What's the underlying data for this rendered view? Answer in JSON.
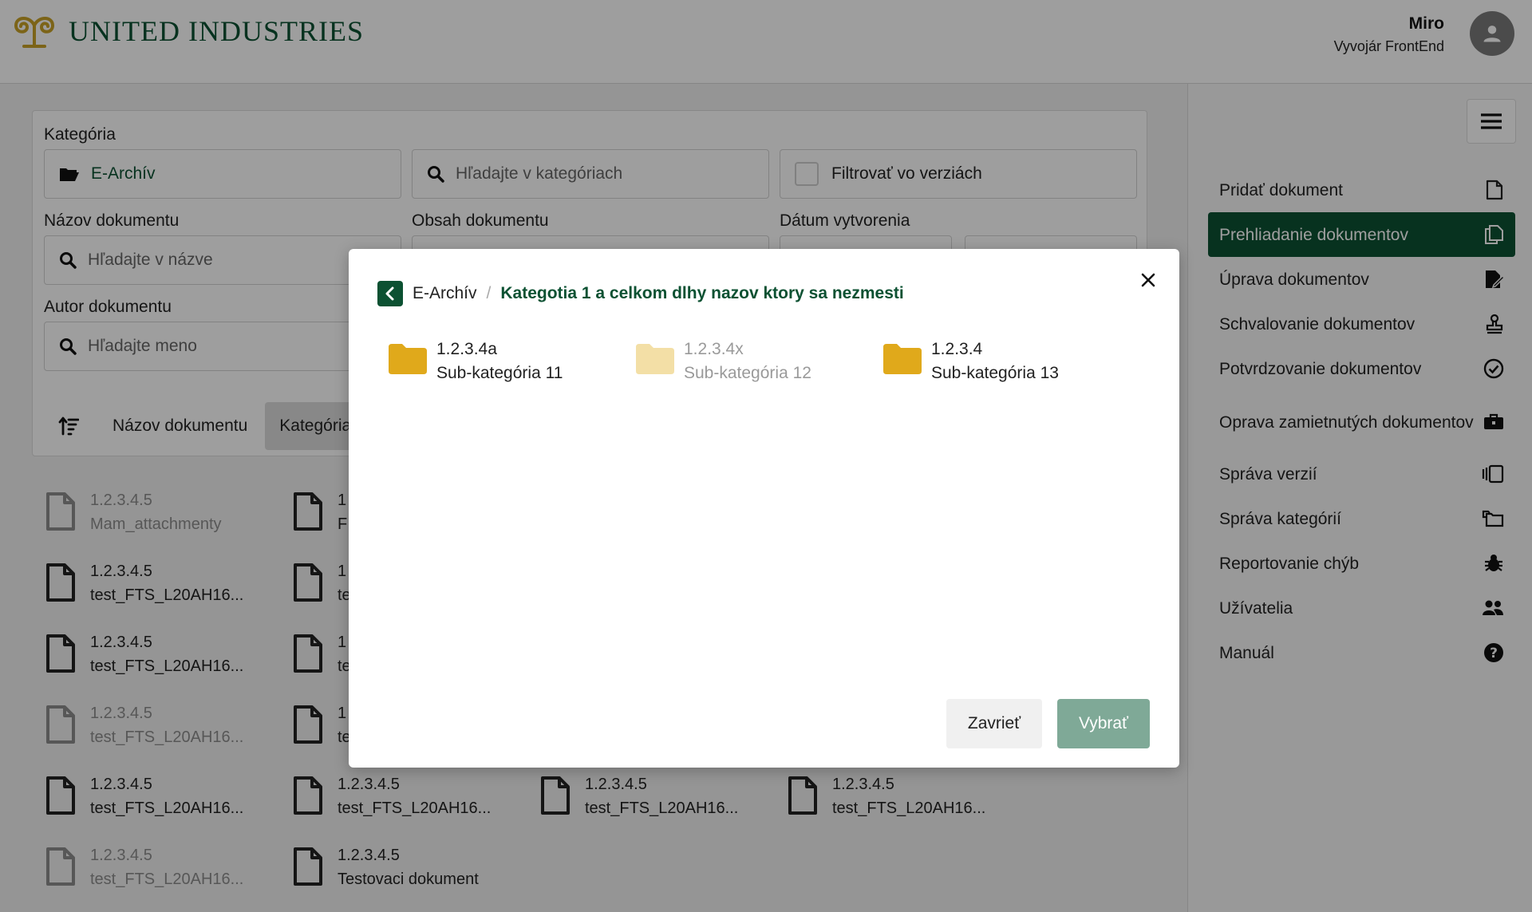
{
  "header": {
    "brand": "UNITED INDUSTRIES",
    "user_name": "Miro",
    "user_role": "Vyvojár FrontEnd"
  },
  "filters": {
    "category_label": "Kategória",
    "category_value": "E-Archív",
    "category_search_placeholder": "Hľadajte v kategóriach",
    "filter_versions_label": "Filtrovať vo verziách",
    "doc_name_label": "Názov dokumentu",
    "doc_name_placeholder": "Hľadajte v názve",
    "doc_content_label": "Obsah dokumentu",
    "created_label": "Dátum vytvorenia",
    "author_label": "Autor dokumentu",
    "author_placeholder": "Hľadajte meno"
  },
  "sort": {
    "name_label": "Názov dokumentu",
    "category_label": "Kategória"
  },
  "files": [
    {
      "id": "1.2.3.4.5",
      "name": "Mam_attachmenty",
      "dim": true
    },
    {
      "id": "1",
      "name": "F",
      "dim": false
    },
    {
      "id": "1.2.3.4.5",
      "name": "test_FTS_L20AH16...",
      "dim": false
    },
    {
      "id": "1",
      "name": "te",
      "dim": false
    },
    {
      "id": "1.2.3.4.5",
      "name": "test_FTS_L20AH16...",
      "dim": false
    },
    {
      "id": "1",
      "name": "te",
      "dim": false
    },
    {
      "id": "1.2.3.4.5",
      "name": "test_FTS_L20AH16...",
      "dim": true
    },
    {
      "id": "1",
      "name": "te",
      "dim": false
    },
    {
      "id": "1.2.3.4.5",
      "name": "test_FTS_L20AH16...",
      "dim": false
    },
    {
      "id": "1.2.3.4.5",
      "name": "test_FTS_L20AH16...",
      "dim": false
    },
    {
      "id": "1.2.3.4.5",
      "name": "test_FTS_L20AH16...",
      "dim": false
    },
    {
      "id": "1.2.3.4.5",
      "name": "test_FTS_L20AH16...",
      "dim": false
    },
    {
      "id": "1.2.3.4.5",
      "name": "test_FTS_L20AH16...",
      "dim": true
    },
    {
      "id": "1.2.3.4.5",
      "name": "Testovaci dokument",
      "dim": false
    }
  ],
  "nav": [
    {
      "label": "Pridať dokument",
      "icon": "file-add-icon"
    },
    {
      "label": "Prehliadanie dokumentov",
      "icon": "files-icon",
      "active": true
    },
    {
      "label": "Úprava dokumentov",
      "icon": "file-edit-icon"
    },
    {
      "label": "Schvalovanie dokumentov",
      "icon": "stamp-icon"
    },
    {
      "label": "Potvrdzovanie dokumentov",
      "icon": "check-circle-icon"
    },
    {
      "label": "Oprava zamietnutých dokumentov",
      "icon": "toolbox-icon"
    },
    {
      "label": "Správa verzií",
      "icon": "versions-icon"
    },
    {
      "label": "Správa kategórií",
      "icon": "folders-icon"
    },
    {
      "label": "Reportovanie chýb",
      "icon": "bug-icon"
    },
    {
      "label": "Užívatelia",
      "icon": "users-icon"
    },
    {
      "label": "Manuál",
      "icon": "help-icon"
    }
  ],
  "modal": {
    "breadcrumb_root": "E-Archív",
    "breadcrumb_current": "Kategotia 1 a celkom dlhy nazov ktory sa nezmesti",
    "folders": [
      {
        "code": "1.2.3.4a",
        "name": "Sub-kategória 11",
        "dim": false
      },
      {
        "code": "1.2.3.4x",
        "name": "Sub-kategória 12",
        "dim": true
      },
      {
        "code": "1.2.3.4",
        "name": "Sub-kategória 13",
        "dim": false
      }
    ],
    "close_label": "Zavrieť",
    "select_label": "Vybrať"
  },
  "colors": {
    "brand_green": "#0c5132",
    "logo_gold": "#c9a227",
    "folder_yellow": "#e0a91b"
  }
}
